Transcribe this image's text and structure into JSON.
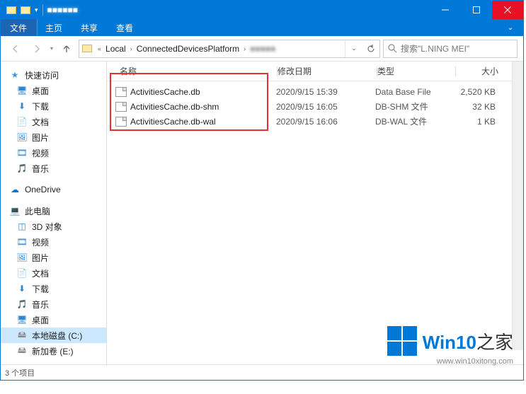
{
  "titlebar": {
    "title_obscured": "■■■■■■"
  },
  "ribbon": {
    "file": "文件",
    "home": "主页",
    "share": "共享",
    "view": "查看"
  },
  "breadcrumb": {
    "segments": [
      "Local",
      "ConnectedDevicesPlatform"
    ],
    "obscured_tail": "■■■■■"
  },
  "search": {
    "placeholder": "搜索\"L.NING MEI\""
  },
  "sidebar": {
    "quick": "快速访问",
    "desktop": "桌面",
    "downloads": "下载",
    "documents": "文档",
    "pictures": "图片",
    "videos": "视频",
    "music": "音乐",
    "onedrive": "OneDrive",
    "thispc": "此电脑",
    "threed": "3D 对象",
    "videos2": "视频",
    "pictures2": "图片",
    "documents2": "文档",
    "downloads2": "下载",
    "music2": "音乐",
    "desktop2": "桌面",
    "cdrive": "本地磁盘 (C:)",
    "edrive": "新加卷 (E:)"
  },
  "columns": {
    "name": "名称",
    "date": "修改日期",
    "type": "类型",
    "size": "大小"
  },
  "files": [
    {
      "name": "ActivitiesCache.db",
      "date": "2020/9/15 15:39",
      "type": "Data Base File",
      "size": "2,520 KB"
    },
    {
      "name": "ActivitiesCache.db-shm",
      "date": "2020/9/15 16:05",
      "type": "DB-SHM 文件",
      "size": "32 KB"
    },
    {
      "name": "ActivitiesCache.db-wal",
      "date": "2020/9/15 16:06",
      "type": "DB-WAL 文件",
      "size": "1 KB"
    }
  ],
  "status": "3 个项目",
  "watermark": {
    "brand_a": "Win10",
    "brand_b": "之家",
    "url": "www.win10xitong.com"
  }
}
